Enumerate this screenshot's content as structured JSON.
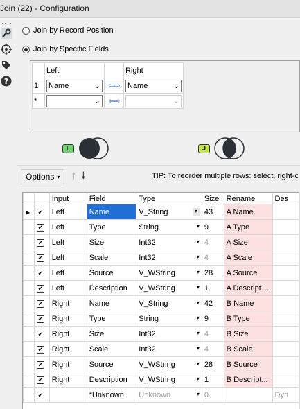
{
  "window": {
    "title": "Join (22) - Configuration"
  },
  "left_icons": [
    "wrench-icon",
    "target-icon",
    "tag-icon",
    "help-icon"
  ],
  "join_options": {
    "by_position": "Join by Record Position",
    "by_fields": "Join by Specific Fields",
    "selected": "by_fields"
  },
  "field_mapping": {
    "left_header": "Left",
    "right_header": "Right",
    "rows": [
      {
        "marker": "1",
        "left": "Name",
        "right": "Name"
      },
      {
        "marker": "*",
        "left": "",
        "right": ""
      }
    ]
  },
  "venn": {
    "left_tag": "L",
    "join_tag": "J"
  },
  "toolbar": {
    "options_label": "Options",
    "up_icon": "arrow-up-icon",
    "down_icon": "arrow-down-icon",
    "tip": "TIP: To reorder multiple rows: select, right-c"
  },
  "grid": {
    "headers": [
      "Input",
      "Field",
      "Type",
      "Size",
      "Rename",
      "Des"
    ],
    "rows": [
      {
        "input": "Left",
        "field": "Name",
        "type": "V_String",
        "size": "43",
        "rename": "A Name",
        "desc": ""
      },
      {
        "input": "Left",
        "field": "Type",
        "type": "String",
        "size": "9",
        "rename": "A Type",
        "desc": ""
      },
      {
        "input": "Left",
        "field": "Size",
        "type": "Int32",
        "size": "4",
        "rename": "A Size",
        "desc": ""
      },
      {
        "input": "Left",
        "field": "Scale",
        "type": "Int32",
        "size": "4",
        "rename": "A Scale",
        "desc": ""
      },
      {
        "input": "Left",
        "field": "Source",
        "type": "V_WString",
        "size": "28",
        "rename": "A Source",
        "desc": ""
      },
      {
        "input": "Left",
        "field": "Description",
        "type": "V_WString",
        "size": "1",
        "rename": "A Descript...",
        "desc": ""
      },
      {
        "input": "Right",
        "field": "Name",
        "type": "V_String",
        "size": "42",
        "rename": "B Name",
        "desc": ""
      },
      {
        "input": "Right",
        "field": "Type",
        "type": "String",
        "size": "9",
        "rename": "B Type",
        "desc": ""
      },
      {
        "input": "Right",
        "field": "Size",
        "type": "Int32",
        "size": "4",
        "rename": "B Size",
        "desc": ""
      },
      {
        "input": "Right",
        "field": "Scale",
        "type": "Int32",
        "size": "4",
        "rename": "B Scale",
        "desc": ""
      },
      {
        "input": "Right",
        "field": "Source",
        "type": "V_WString",
        "size": "28",
        "rename": "B Source",
        "desc": ""
      },
      {
        "input": "Right",
        "field": "Description",
        "type": "V_WString",
        "size": "1",
        "rename": "B Descript...",
        "desc": ""
      },
      {
        "input": "",
        "field": "*Unknown",
        "type": "Unknown",
        "size": "0",
        "rename": "",
        "desc": "Dyn"
      }
    ]
  },
  "colors": {
    "accent": "#1f6fd6",
    "rename_bg": "#fde1e1",
    "left_tag": "#6fd36f",
    "join_tag": "#c8e85a"
  }
}
